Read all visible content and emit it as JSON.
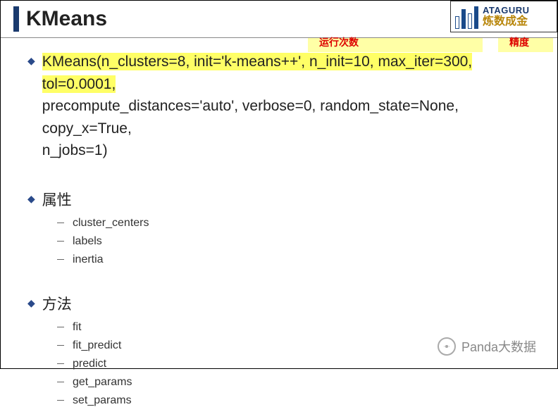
{
  "title": "KMeans",
  "logo": {
    "en": "ATAGURU",
    "cn": "炼数成金"
  },
  "annotations": {
    "runs": "运行次数",
    "precision": "精度"
  },
  "signature": {
    "line1_hl": "KMeans(n_clusters=8, init='k-means++', n_init=10, max_iter=300, tol=0.0001,",
    "line2": "precompute_distances='auto', verbose=0, random_state=None, copy_x=True,",
    "line3": "n_jobs=1)"
  },
  "sections": {
    "attrs_title": "属性",
    "attrs": [
      "cluster_centers",
      "labels",
      "inertia"
    ],
    "methods_title": "方法",
    "methods": [
      "fit",
      "fit_predict",
      "predict",
      "get_params",
      "set_params"
    ]
  },
  "watermark": "Panda大数据"
}
